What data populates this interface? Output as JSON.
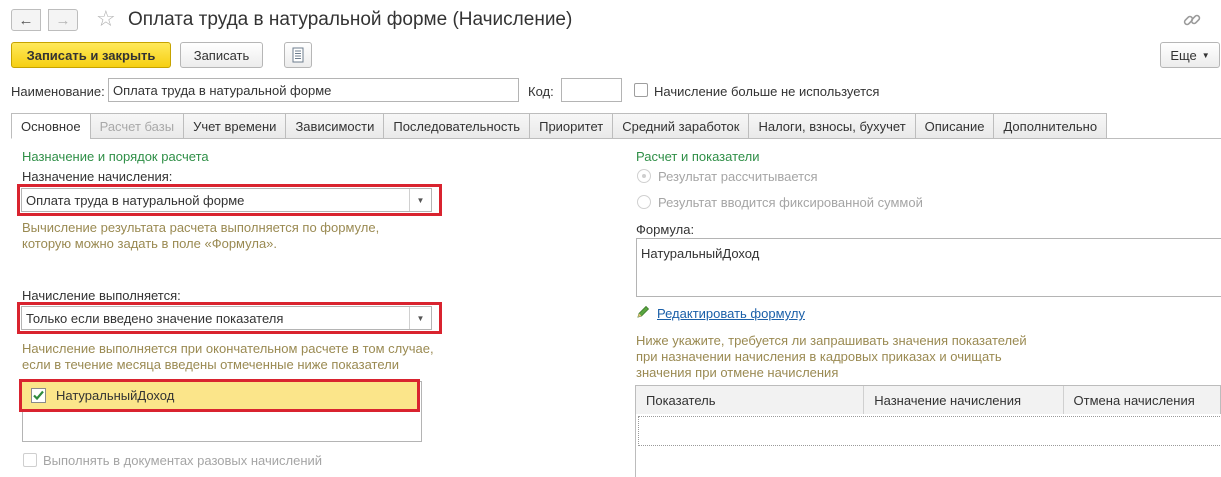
{
  "window": {
    "title": "Оплата труда в натуральной форме (Начисление)"
  },
  "toolbar": {
    "save_close_label": "Записать и закрыть",
    "save_label": "Записать",
    "more_label": "Еще"
  },
  "header": {
    "name_label": "Наименование:",
    "name_value": "Оплата труда в натуральной форме",
    "code_label": "Код:",
    "code_value": "",
    "not_used_label": "Начисление больше не используется"
  },
  "tabs": [
    {
      "label": "Основное",
      "state": "active"
    },
    {
      "label": "Расчет базы",
      "state": "disabled"
    },
    {
      "label": "Учет времени",
      "state": "normal"
    },
    {
      "label": "Зависимости",
      "state": "normal"
    },
    {
      "label": "Последовательность",
      "state": "normal"
    },
    {
      "label": "Приоритет",
      "state": "normal"
    },
    {
      "label": "Средний заработок",
      "state": "normal"
    },
    {
      "label": "Налоги, взносы, бухучет",
      "state": "normal"
    },
    {
      "label": "Описание",
      "state": "normal"
    },
    {
      "label": "Дополнительно",
      "state": "normal"
    }
  ],
  "left": {
    "section_title": "Назначение и порядок расчета",
    "purpose_label": "Назначение начисления:",
    "purpose_value": "Оплата труда в натуральной форме",
    "purpose_hint_1": "Вычисление результата расчета выполняется по формуле,",
    "purpose_hint_2": "которую можно задать в поле «Формула».",
    "execution_label": "Начисление выполняется:",
    "execution_value": "Только если введено значение показателя",
    "execution_hint_1": "Начисление выполняется при окончательном расчете в том случае,",
    "execution_hint_2": "если в течение месяца введены отмеченные ниже показатели",
    "indicator_item": "НатуральныйДоход",
    "one_time_label": "Выполнять в документах разовых начислений"
  },
  "right": {
    "section_title": "Расчет и показатели",
    "radio_calculated": "Результат рассчитывается",
    "radio_fixed": "Результат вводится фиксированной суммой",
    "formula_label": "Формула:",
    "formula_value": "НатуральныйДоход",
    "edit_formula_link": "Редактировать формулу",
    "note_1": "Ниже укажите, требуется ли запрашивать значения показателей",
    "note_2": "при назначении начисления в кадровых приказах и очищать",
    "note_3": "значения при отмене начисления",
    "table_columns": [
      "Показатель",
      "Назначение начисления",
      "Отмена начисления"
    ]
  },
  "colors": {
    "accent_yellow": "#f6cf12",
    "section_green": "#2f8f47",
    "highlight_red": "#d9232f",
    "link_blue": "#1a5fa8"
  }
}
